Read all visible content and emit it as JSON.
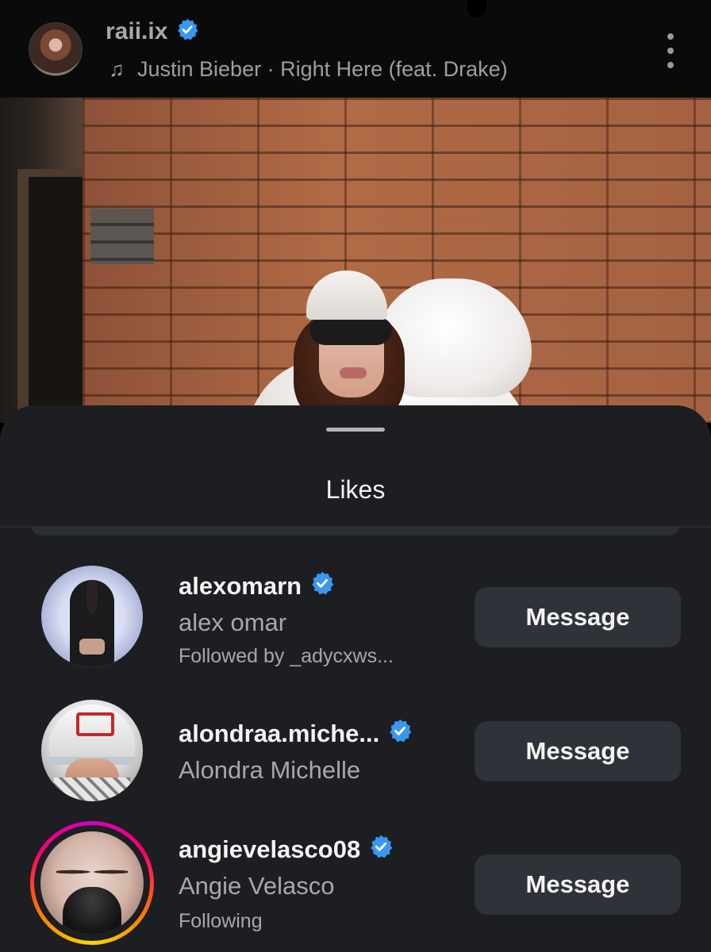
{
  "header": {
    "username": "raii.ix",
    "audio_label": "Justin Bieber · Right Here (feat. Drake)",
    "icons": {
      "verified": "verified-badge-icon",
      "audio": "music-note-icon",
      "more": "more-vertical-icon"
    }
  },
  "sheet": {
    "title": "Likes",
    "likes": [
      {
        "username": "alexomarn",
        "full_name": "alex omar",
        "subtitle": "Followed by _adycxws...",
        "button_label": "Message",
        "verified": true,
        "story_ring": false
      },
      {
        "username": "alondraa.miche...",
        "full_name": "Alondra Michelle",
        "subtitle": "",
        "button_label": "Message",
        "verified": true,
        "story_ring": false
      },
      {
        "username": "angievelasco08",
        "full_name": "Angie Velasco",
        "subtitle": "Following",
        "button_label": "Message",
        "verified": true,
        "story_ring": true
      }
    ]
  },
  "colors": {
    "verified_blue": "#3897f0",
    "sheet_bg": "#1c1e22",
    "button_bg": "#2f3238"
  }
}
